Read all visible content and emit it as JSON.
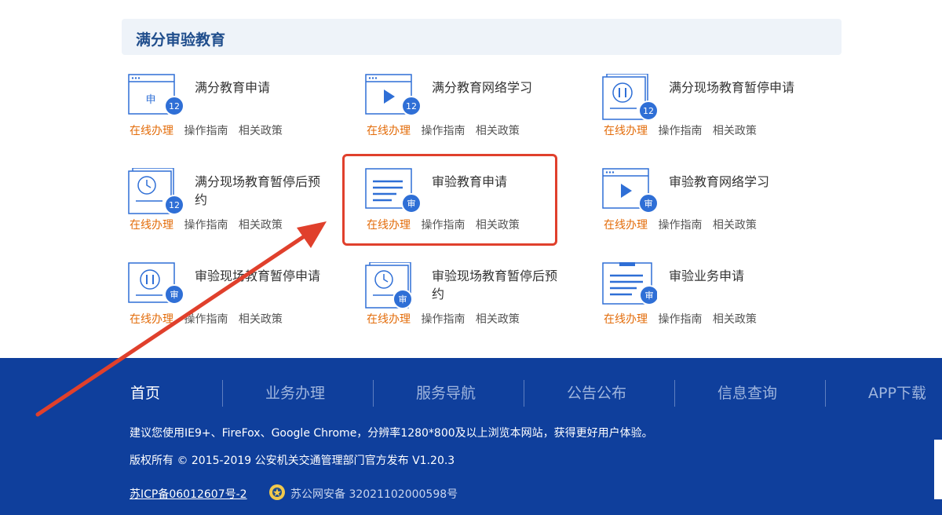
{
  "section": {
    "title": "满分审验教育"
  },
  "services": [
    {
      "name": "满分教育申请",
      "icon": "application-form-icon",
      "badge": "12",
      "glyph": "申"
    },
    {
      "name": "满分教育网络学习",
      "icon": "video-play-icon",
      "badge": "12"
    },
    {
      "name": "满分现场教育暂停申请",
      "icon": "pause-icon",
      "badge": "12"
    },
    {
      "name": "满分现场教育暂停后预约",
      "icon": "clock-icon",
      "badge": "12"
    },
    {
      "name": "审验教育申请",
      "icon": "document-lines-icon",
      "badge": "审"
    },
    {
      "name": "审验教育网络学习",
      "icon": "video-play-icon",
      "badge": "审"
    },
    {
      "name": "审验现场教育暂停申请",
      "icon": "pause-icon",
      "badge": "审"
    },
    {
      "name": "审验现场教育暂停后预约",
      "icon": "clock-icon",
      "badge": "审"
    },
    {
      "name": "审验业务申请",
      "icon": "clipboard-icon",
      "badge": "审"
    }
  ],
  "links": {
    "online": "在线办理",
    "guide": "操作指南",
    "policy": "相关政策"
  },
  "footer": {
    "nav": [
      "首页",
      "业务办理",
      "服务导航",
      "公告公布",
      "信息查询",
      "APP下载"
    ],
    "browser_note": "建议您使用IE9+、FireFox、Google Chrome，分辨率1280*800及以上浏览本网站，获得更好用户体验。",
    "copyright": "版权所有 © 2015-2019 公安机关交通管理部门官方发布 V1.20.3",
    "icp": "苏ICP备06012607号-2",
    "police_record": "苏公网安备 32021102000598号"
  },
  "colors": {
    "accent_orange": "#e36c0a",
    "footer_blue": "#0f3f9c",
    "icon_blue": "#2f6fd6",
    "highlight_red": "#e0402c"
  }
}
